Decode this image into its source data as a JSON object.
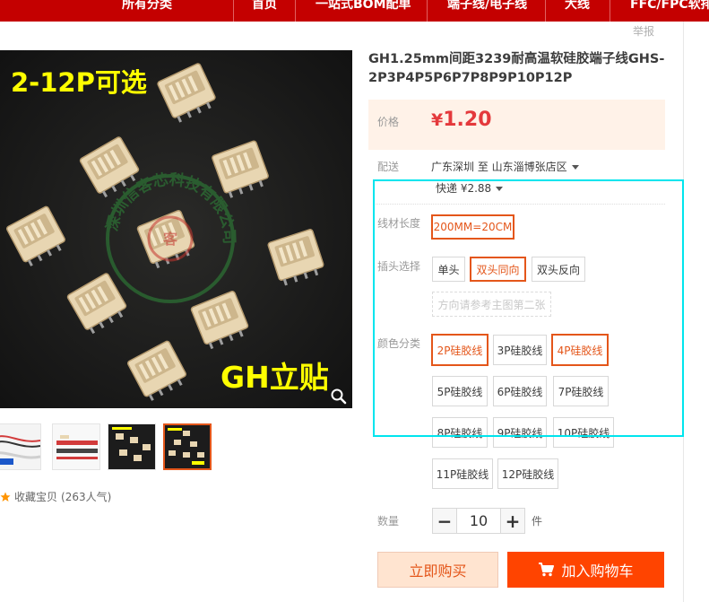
{
  "nav": {
    "items": [
      "所有分类",
      "首页",
      "一站式BOM配单",
      "端子线/电子线",
      "大线",
      "FFC/FPC软排"
    ]
  },
  "report_label": "举报",
  "main_image": {
    "overlay_top": "2-12P可选",
    "overlay_bottom": "GH立贴",
    "watermark": "深圳信客芯科技有限公司",
    "stamp": "客"
  },
  "thumbnails": {
    "count": 4,
    "active_index": 3
  },
  "favorite": {
    "label": "收藏宝贝",
    "popularity": "(263人气)"
  },
  "product": {
    "title": "GH1.25mm间距3239耐高温软硅胶端子线GHS-2P3P4P5P6P7P8P9P10P12P"
  },
  "price": {
    "label": "价格",
    "currency": "¥",
    "value": "1.20"
  },
  "shipping": {
    "label": "配送",
    "route": "广东深圳 至  山东淄博张店区",
    "express": "快递 ¥2.88"
  },
  "sku": {
    "length": {
      "label": "线材长度",
      "options": [
        "200MM=20CM"
      ],
      "selected": 0
    },
    "plug": {
      "label": "插头选择",
      "options": [
        "单头",
        "双头同向",
        "双头反向"
      ],
      "selected": 1,
      "hint": "方向请参考主图第二张"
    },
    "color": {
      "label": "颜色分类",
      "options": [
        "2P硅胶线",
        "3P硅胶线",
        "4P硅胶线",
        "5P硅胶线",
        "6P硅胶线",
        "7P硅胶线",
        "8P硅胶线",
        "9P硅胶线",
        "10P硅胶线",
        "11P硅胶线",
        "12P硅胶线"
      ],
      "selected": [
        0,
        2
      ]
    }
  },
  "quantity": {
    "label": "数量",
    "value": "10",
    "minus": "−",
    "plus": "+",
    "unit": "件"
  },
  "actions": {
    "buy_now": "立即购买",
    "add_to_cart": "加入购物车"
  },
  "colors": {
    "nav_bg": "#c40000",
    "accent": "#e4561a",
    "price": "#e4393c",
    "cart_bg": "#ff4400",
    "highlight": "#00e5ee"
  }
}
